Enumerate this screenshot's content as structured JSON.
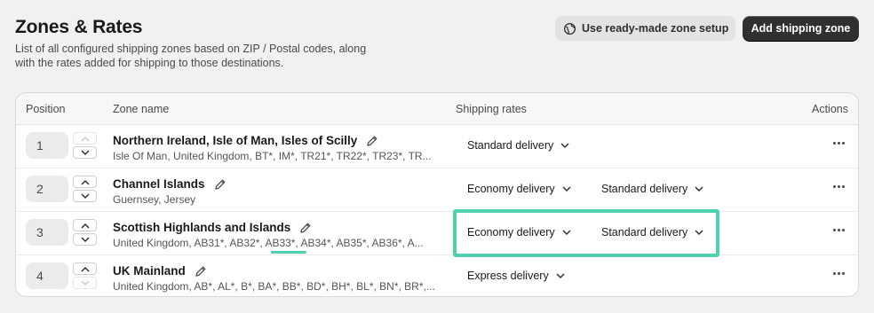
{
  "header": {
    "title": "Zones & Rates",
    "subtitle": "List of all configured shipping zones based on ZIP / Postal codes, along with the rates added for shipping to those destinations.",
    "ready_made_label": "Use ready-made zone setup",
    "add_zone_label": "Add shipping zone"
  },
  "table": {
    "columns": {
      "position": "Position",
      "zone_name": "Zone name",
      "shipping_rates": "Shipping rates",
      "actions": "Actions"
    },
    "rows": [
      {
        "position": "1",
        "name": "Northern Ireland, Isle of Man, Isles of Scilly",
        "desc": "Isle Of Man, United Kingdom, BT*, IM*, TR21*, TR22*, TR23*, TR...",
        "rates": [
          "Standard delivery"
        ]
      },
      {
        "position": "2",
        "name": "Channel Islands",
        "desc": "Guernsey, Jersey",
        "rates": [
          "Economy delivery",
          "Standard delivery"
        ]
      },
      {
        "position": "3",
        "name": "Scottish Highlands and Islands",
        "desc": "United Kingdom, AB31*, AB32*, AB33*, AB34*, AB35*, AB36*, A...",
        "rates": [
          "Economy delivery",
          "Standard delivery"
        ]
      },
      {
        "position": "4",
        "name": "UK Mainland",
        "desc": "United Kingdom, AB*, AL*, B*, BA*, BB*, BD*, BH*, BL*, BN*, BR*,...",
        "rates": [
          "Express delivery"
        ]
      }
    ]
  },
  "colors": {
    "highlight": "#4fd1b0",
    "primary_button": "#303030"
  }
}
